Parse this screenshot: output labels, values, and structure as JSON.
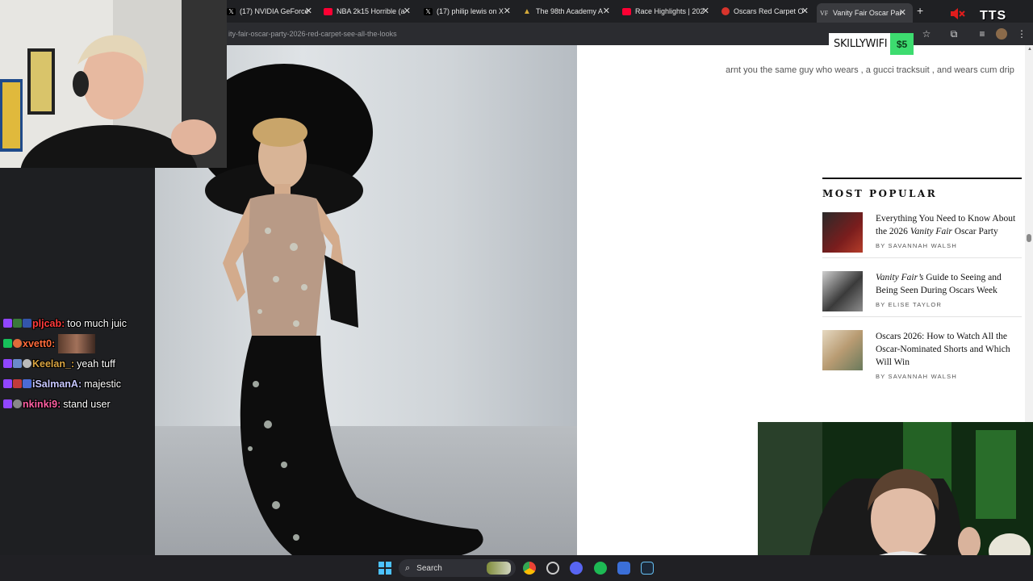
{
  "browser": {
    "tabs": [
      {
        "title": "(17) NVIDIA GeForce",
        "icon": "x-logo-icon"
      },
      {
        "title": "NBA 2k15 Horrible (a",
        "icon": "youtube-icon"
      },
      {
        "title": "(17) philip lewis on X",
        "icon": "x-logo-icon"
      },
      {
        "title": "The 98th Academy A",
        "icon": "academy-icon"
      },
      {
        "title": "Race Highlights | 202",
        "icon": "youtube-icon"
      },
      {
        "title": "Oscars Red Carpet O",
        "icon": "oscars-icon"
      },
      {
        "title": "Vanity Fair Oscar Par",
        "icon": "vanity-fair-icon"
      }
    ],
    "new_tab": "+",
    "url": "ity-fair-oscar-party-2026-red-carpet-see-all-the-looks"
  },
  "overlay": {
    "tts_label": "TTS",
    "donation": {
      "name": "SKILLYWIFI",
      "amount": "$5"
    },
    "tts_message": "arnt you the same guy who wears , a gucci tracksuit , and wears cum drip"
  },
  "most_popular": {
    "heading": "MOST POPULAR",
    "items": [
      {
        "headline_pre": "Everything You Need to Know About the 2026 ",
        "headline_em": "Vanity Fair",
        "headline_post": " Oscar Party",
        "byline": "BY SAVANNAH WALSH"
      },
      {
        "headline_pre": "",
        "headline_em": "Vanity Fair’s",
        "headline_post": " Guide to Seeing and Being Seen During Oscars Week",
        "byline": "BY ELISE TAYLOR"
      },
      {
        "headline_pre": "Oscars 2026: How to Watch All the Oscar-Nominated Shorts and Which Will Win",
        "headline_em": "",
        "headline_post": "",
        "byline": "BY SAVANNAH WALSH"
      }
    ]
  },
  "chat": [
    {
      "user": "pljcab:",
      "text": "too much juic",
      "color": "#ff3b3b"
    },
    {
      "user": "xvett0:",
      "text": "",
      "color": "#ff6b3b"
    },
    {
      "user": "Keelan_:",
      "text": "yeah tuff",
      "color": "#d9a441"
    },
    {
      "user": "iSalmanA:",
      "text": "majestic",
      "color": "#c7c7ff"
    },
    {
      "user": "nkinki9:",
      "text": "stand user",
      "color": "#ff5fa2"
    }
  ],
  "taskbar": {
    "search_label": "Search"
  },
  "colors": {
    "donation_accent": "#3ddc6f",
    "page_bg": "#ffffff",
    "tab_bar": "#1f2023"
  }
}
